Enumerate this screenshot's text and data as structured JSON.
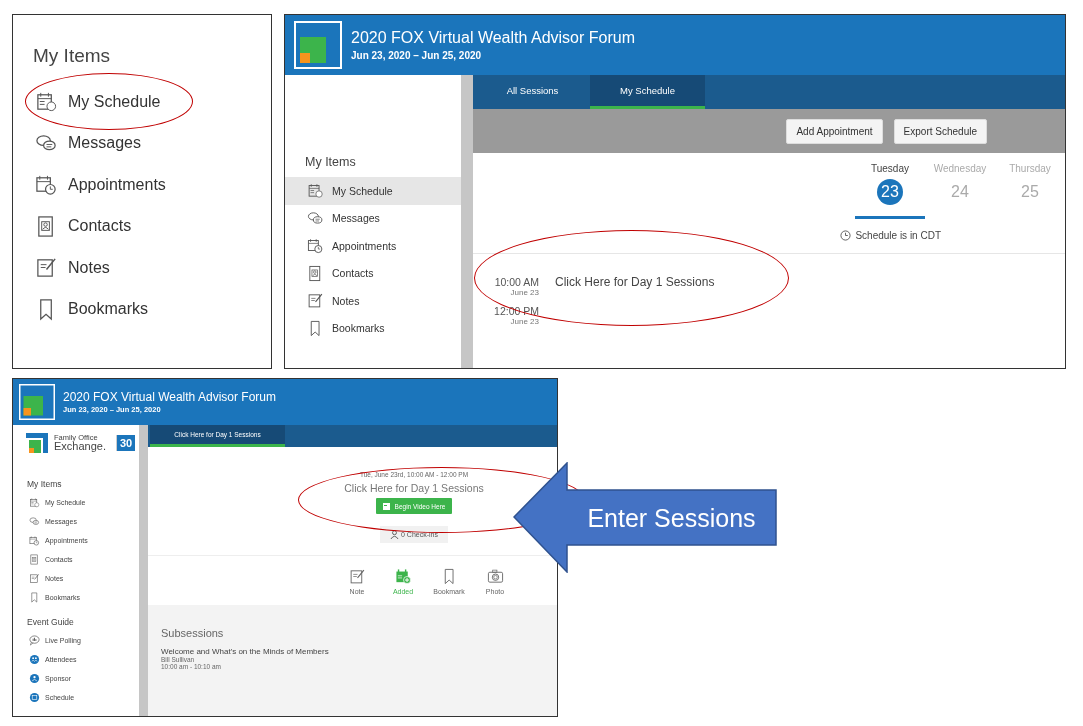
{
  "closeup": {
    "heading": "My Items",
    "items": [
      {
        "label": "My Schedule",
        "kind": "schedule"
      },
      {
        "label": "Messages",
        "kind": "messages"
      },
      {
        "label": "Appointments",
        "kind": "appointments"
      },
      {
        "label": "Contacts",
        "kind": "contacts"
      },
      {
        "label": "Notes",
        "kind": "notes"
      },
      {
        "label": "Bookmarks",
        "kind": "bookmarks"
      }
    ]
  },
  "schedule_window": {
    "title": "2020 FOX Virtual Wealth Advisor Forum",
    "dates": "Jun 23, 2020 – Jun 25, 2020",
    "sidebar": {
      "heading": "My Items",
      "items": [
        {
          "label": "My Schedule",
          "kind": "schedule",
          "selected": true
        },
        {
          "label": "Messages",
          "kind": "messages",
          "selected": false
        },
        {
          "label": "Appointments",
          "kind": "appointments",
          "selected": false
        },
        {
          "label": "Contacts",
          "kind": "contacts",
          "selected": false
        },
        {
          "label": "Notes",
          "kind": "notes",
          "selected": false
        },
        {
          "label": "Bookmarks",
          "kind": "bookmarks",
          "selected": false
        }
      ]
    },
    "tabs": [
      {
        "label": "All Sessions",
        "selected": false
      },
      {
        "label": "My Schedule",
        "selected": true
      }
    ],
    "buttons": [
      "Add Appointment",
      "Export Schedule"
    ],
    "days": [
      {
        "name": "Tuesday",
        "number": "23",
        "selected": true
      },
      {
        "name": "Wednesday",
        "number": "24",
        "selected": false
      },
      {
        "name": "Thursday",
        "number": "25",
        "selected": false
      }
    ],
    "timezone": "Schedule is in CDT",
    "rows": [
      {
        "time": "10:00 AM",
        "date": "June 23",
        "title": "Click Here for Day 1 Sessions"
      },
      {
        "time": "12:00 PM",
        "date": "June 23"
      }
    ]
  },
  "session_window": {
    "title": "2020 FOX Virtual Wealth Advisor Forum",
    "dates": "Jun 23, 2020 – Jun 25, 2020",
    "brand": {
      "line1": "Family Office",
      "line2": "Exchange.",
      "badge": "30"
    },
    "sections": [
      {
        "heading": "My Items",
        "items": [
          {
            "label": "My Schedule",
            "kind": "schedule"
          },
          {
            "label": "Messages",
            "kind": "messages"
          },
          {
            "label": "Appointments",
            "kind": "appointments"
          },
          {
            "label": "Contacts",
            "kind": "contacts"
          },
          {
            "label": "Notes",
            "kind": "notes"
          },
          {
            "label": "Bookmarks",
            "kind": "bookmarks"
          }
        ]
      },
      {
        "heading": "Event Guide",
        "items": [
          {
            "label": "Live Polling",
            "kind": "polling"
          },
          {
            "label": "Attendees",
            "kind": "attendees"
          },
          {
            "label": "Sponsor",
            "kind": "sponsor"
          },
          {
            "label": "Schedule",
            "kind": "schedule_circle"
          }
        ]
      }
    ],
    "tabs": [
      {
        "label": "Click Here for Day 1 Sessions",
        "selected": true
      }
    ],
    "when": "Tue, June 23rd, 10:00 AM - 12:00 PM",
    "session_title": "Click Here for Day 1 Sessions",
    "video_button": "Begin Video Here",
    "checkins": "0 Check-ins",
    "actions": [
      {
        "label": "Note",
        "kind": "notes",
        "active": false
      },
      {
        "label": "Added",
        "kind": "added",
        "active": true
      },
      {
        "label": "Bookmark",
        "kind": "bookmarks",
        "active": false
      },
      {
        "label": "Photo",
        "kind": "camera",
        "active": false
      }
    ],
    "subsessions": {
      "heading": "Subsessions",
      "items": [
        {
          "title": "Welcome and What's on the Minds of Members",
          "speaker": "Bill Sullivan",
          "time": "10:00 am - 10:10 am"
        }
      ]
    }
  },
  "callout": {
    "label": "Enter Sessions"
  }
}
